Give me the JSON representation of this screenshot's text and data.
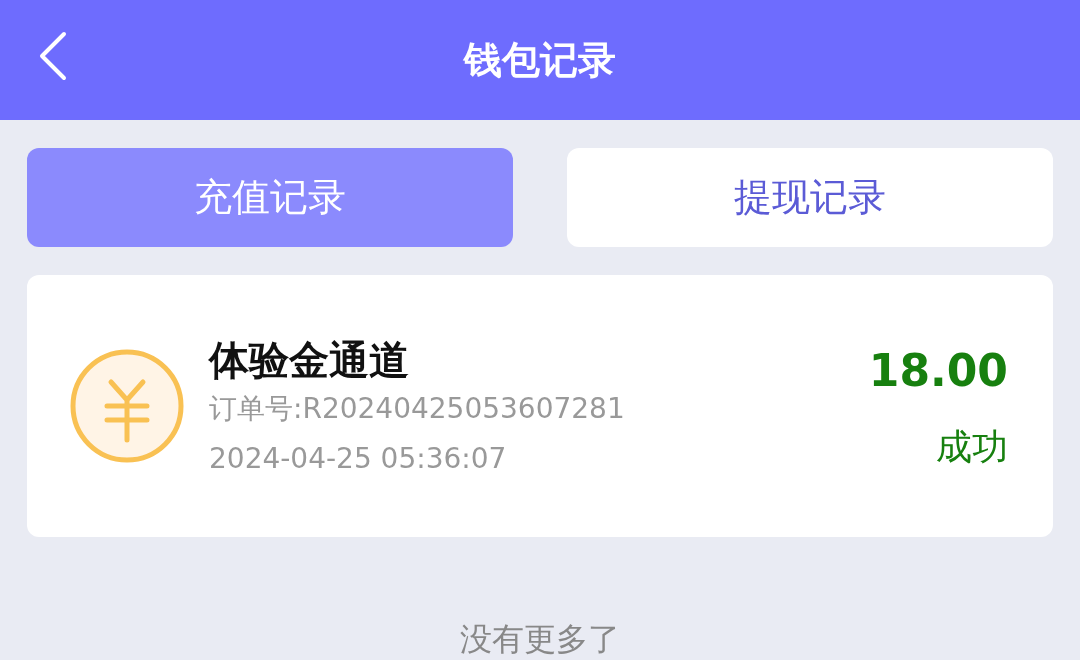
{
  "header": {
    "title": "钱包记录"
  },
  "tabs": [
    {
      "label": "充值记录",
      "selected": true
    },
    {
      "label": "提现记录",
      "selected": false
    }
  ],
  "records": [
    {
      "title": "体验金通道",
      "order": "订单号:R20240425053607281",
      "time": "2024-04-25 05:36:07",
      "amount": "18.00",
      "status": "成功"
    }
  ],
  "footer": "没有更多了"
}
